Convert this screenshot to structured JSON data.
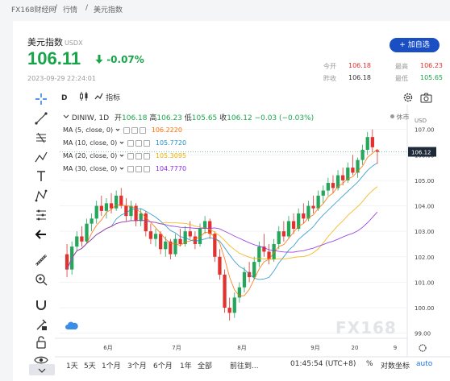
{
  "breadcrumb": {
    "home": "FX168财经网",
    "sep1": "/",
    "section": "行情",
    "sep2": "/",
    "current": "美元指数"
  },
  "instrument": {
    "name": "美元指数",
    "symbol": "USDX",
    "price": "106.11",
    "change_pct": "-0.07%",
    "timestamp": "2023-09-29 22:24:01"
  },
  "add_button": "+ 加自选",
  "stats": {
    "open_label": "今开",
    "open": "106.18",
    "high_label": "最高",
    "high": "106.23",
    "prev_label": "昨收",
    "prev": "106.18",
    "low_label": "最低",
    "low": "105.65"
  },
  "toolbar": {
    "interval": "D",
    "indicators_label": "指标"
  },
  "ohlc_line": {
    "symbol": "DINIW, 1D",
    "open_label": "开",
    "open": "106.18",
    "high_label": "高",
    "high": "106.23",
    "low_label": "低",
    "low": "105.65",
    "close_label": "收",
    "close": "106.12",
    "change": "−0.03 (−0.03%)",
    "market_status": "休市"
  },
  "ma_legend": [
    {
      "label": "MA (5, close, 0)",
      "value": "106.2220",
      "color": "#ff6d00"
    },
    {
      "label": "MA (10, close, 0)",
      "value": "105.7720",
      "color": "#1e90c8"
    },
    {
      "label": "MA (20, close, 0)",
      "value": "105.3095",
      "color": "#f0b000"
    },
    {
      "label": "MA (30, close, 0)",
      "value": "104.7770",
      "color": "#8a2be2"
    }
  ],
  "y_axis": {
    "unit": "USD",
    "ticks": [
      "107.00",
      "106.00",
      "105.00",
      "104.00",
      "103.00",
      "102.00",
      "101.00",
      "100.00",
      "99.00"
    ],
    "current": "106.12"
  },
  "x_axis": {
    "ticks": [
      "6月",
      "7月",
      "8月",
      "9月",
      "20",
      "9"
    ]
  },
  "watermark": "FX168",
  "bottom": {
    "ranges": [
      "1天",
      "5天",
      "1个月",
      "3个月",
      "6个月",
      "1年",
      "全部"
    ],
    "goto": "前往到...",
    "time": "01:45:54 (UTC+8)",
    "pct": "%",
    "log": "对数坐标",
    "auto": "auto"
  },
  "colors": {
    "up": "#26a65b",
    "down": "#e0322e",
    "accent": "#1a4fc4"
  },
  "chart_data": {
    "type": "candlestick",
    "title": "DINIW, 1D",
    "ylim": [
      98.8,
      107.4
    ],
    "candles": [
      {
        "o": 102.1,
        "h": 102.5,
        "l": 101.2,
        "c": 101.5
      },
      {
        "o": 101.5,
        "h": 102.6,
        "l": 101.3,
        "c": 102.4
      },
      {
        "o": 102.4,
        "h": 103.0,
        "l": 102.2,
        "c": 102.8
      },
      {
        "o": 102.8,
        "h": 103.2,
        "l": 102.4,
        "c": 102.6
      },
      {
        "o": 102.6,
        "h": 103.5,
        "l": 102.5,
        "c": 103.3
      },
      {
        "o": 103.3,
        "h": 103.7,
        "l": 103.0,
        "c": 103.5
      },
      {
        "o": 103.5,
        "h": 104.2,
        "l": 103.3,
        "c": 104.0
      },
      {
        "o": 104.0,
        "h": 104.4,
        "l": 103.6,
        "c": 103.8
      },
      {
        "o": 103.8,
        "h": 104.3,
        "l": 103.5,
        "c": 104.1
      },
      {
        "o": 104.1,
        "h": 104.5,
        "l": 103.7,
        "c": 103.9
      },
      {
        "o": 103.9,
        "h": 104.6,
        "l": 103.8,
        "c": 104.4
      },
      {
        "o": 104.4,
        "h": 104.7,
        "l": 103.9,
        "c": 104.0
      },
      {
        "o": 104.0,
        "h": 104.3,
        "l": 103.4,
        "c": 103.6
      },
      {
        "o": 103.6,
        "h": 104.2,
        "l": 103.4,
        "c": 104.0
      },
      {
        "o": 104.0,
        "h": 104.1,
        "l": 103.2,
        "c": 103.4
      },
      {
        "o": 103.4,
        "h": 103.9,
        "l": 103.2,
        "c": 103.7
      },
      {
        "o": 103.7,
        "h": 103.8,
        "l": 102.8,
        "c": 103.0
      },
      {
        "o": 103.0,
        "h": 103.3,
        "l": 102.5,
        "c": 102.7
      },
      {
        "o": 102.7,
        "h": 103.1,
        "l": 102.4,
        "c": 102.9
      },
      {
        "o": 102.9,
        "h": 103.0,
        "l": 102.1,
        "c": 102.3
      },
      {
        "o": 102.3,
        "h": 102.8,
        "l": 102.0,
        "c": 102.6
      },
      {
        "o": 102.6,
        "h": 102.7,
        "l": 101.9,
        "c": 102.1
      },
      {
        "o": 102.1,
        "h": 102.9,
        "l": 102.0,
        "c": 102.7
      },
      {
        "o": 102.7,
        "h": 103.1,
        "l": 102.4,
        "c": 102.5
      },
      {
        "o": 102.5,
        "h": 103.2,
        "l": 102.4,
        "c": 103.0
      },
      {
        "o": 103.0,
        "h": 103.4,
        "l": 102.7,
        "c": 102.8
      },
      {
        "o": 102.8,
        "h": 103.0,
        "l": 102.3,
        "c": 102.5
      },
      {
        "o": 102.5,
        "h": 103.3,
        "l": 102.4,
        "c": 103.1
      },
      {
        "o": 103.1,
        "h": 103.6,
        "l": 102.9,
        "c": 103.4
      },
      {
        "o": 103.4,
        "h": 103.5,
        "l": 102.7,
        "c": 102.9
      },
      {
        "o": 102.9,
        "h": 103.0,
        "l": 101.8,
        "c": 102.0
      },
      {
        "o": 102.0,
        "h": 102.3,
        "l": 101.1,
        "c": 101.3
      },
      {
        "o": 101.3,
        "h": 101.5,
        "l": 99.8,
        "c": 100.0
      },
      {
        "o": 100.0,
        "h": 100.4,
        "l": 99.5,
        "c": 99.8
      },
      {
        "o": 99.8,
        "h": 100.6,
        "l": 99.6,
        "c": 100.4
      },
      {
        "o": 100.4,
        "h": 101.0,
        "l": 100.2,
        "c": 100.8
      },
      {
        "o": 100.8,
        "h": 101.6,
        "l": 100.6,
        "c": 101.4
      },
      {
        "o": 101.4,
        "h": 101.8,
        "l": 101.0,
        "c": 101.2
      },
      {
        "o": 101.2,
        "h": 102.0,
        "l": 101.1,
        "c": 101.8
      },
      {
        "o": 101.8,
        "h": 102.6,
        "l": 101.6,
        "c": 102.4
      },
      {
        "o": 102.4,
        "h": 102.9,
        "l": 102.0,
        "c": 102.2
      },
      {
        "o": 102.2,
        "h": 102.5,
        "l": 101.7,
        "c": 101.9
      },
      {
        "o": 101.9,
        "h": 102.7,
        "l": 101.8,
        "c": 102.5
      },
      {
        "o": 102.5,
        "h": 103.2,
        "l": 102.3,
        "c": 103.0
      },
      {
        "o": 103.0,
        "h": 103.4,
        "l": 102.6,
        "c": 102.8
      },
      {
        "o": 102.8,
        "h": 103.6,
        "l": 102.7,
        "c": 103.4
      },
      {
        "o": 103.4,
        "h": 103.7,
        "l": 102.9,
        "c": 103.1
      },
      {
        "o": 103.1,
        "h": 103.9,
        "l": 103.0,
        "c": 103.7
      },
      {
        "o": 103.7,
        "h": 104.1,
        "l": 103.3,
        "c": 103.5
      },
      {
        "o": 103.5,
        "h": 104.2,
        "l": 103.4,
        "c": 104.0
      },
      {
        "o": 104.0,
        "h": 104.4,
        "l": 103.7,
        "c": 103.9
      },
      {
        "o": 103.9,
        "h": 104.6,
        "l": 103.8,
        "c": 104.4
      },
      {
        "o": 104.4,
        "h": 104.8,
        "l": 104.1,
        "c": 104.6
      },
      {
        "o": 104.6,
        "h": 105.1,
        "l": 104.4,
        "c": 104.9
      },
      {
        "o": 104.9,
        "h": 105.2,
        "l": 104.5,
        "c": 104.7
      },
      {
        "o": 104.7,
        "h": 105.4,
        "l": 104.6,
        "c": 105.2
      },
      {
        "o": 105.2,
        "h": 105.5,
        "l": 104.8,
        "c": 105.0
      },
      {
        "o": 105.0,
        "h": 105.7,
        "l": 104.9,
        "c": 105.5
      },
      {
        "o": 105.5,
        "h": 106.0,
        "l": 105.2,
        "c": 105.3
      },
      {
        "o": 105.3,
        "h": 105.9,
        "l": 105.1,
        "c": 105.8
      },
      {
        "o": 105.8,
        "h": 106.4,
        "l": 105.6,
        "c": 106.2
      },
      {
        "o": 106.2,
        "h": 106.9,
        "l": 106.0,
        "c": 106.7
      },
      {
        "o": 106.7,
        "h": 107.0,
        "l": 106.1,
        "c": 106.3
      },
      {
        "o": 106.18,
        "h": 106.23,
        "l": 105.65,
        "c": 106.12
      }
    ]
  }
}
